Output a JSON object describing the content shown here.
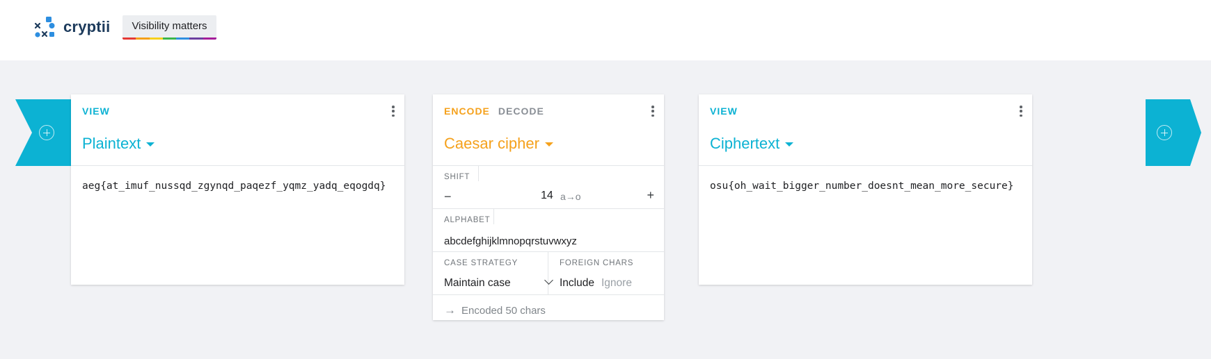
{
  "header": {
    "logo_text": "cryptii",
    "badge_label": "Visibility matters",
    "rainbow_colors": [
      "#e53935",
      "#f4a019",
      "#f7d01c",
      "#3bb54a",
      "#2f8fe0",
      "#6b3fa0",
      "#a51d9a"
    ]
  },
  "colors": {
    "accent_cyan": "#0cb2d3",
    "accent_orange": "#f5a11c"
  },
  "plaintext_card": {
    "tab": "VIEW",
    "title": "Plaintext",
    "content": "aeg{at_imuf_nussqd_zgynqd_paqezf_yqmz_yadq_eqogdq}"
  },
  "caesar_card": {
    "tab_encode": "ENCODE",
    "tab_decode": "DECODE",
    "title": "Caesar cipher",
    "shift": {
      "label": "SHIFT",
      "minus": "−",
      "value": "14",
      "mapping": "a→o",
      "plus": "+"
    },
    "alphabet": {
      "label": "ALPHABET",
      "value": "abcdefghijklmnopqrstuvwxyz"
    },
    "case_strategy": {
      "label": "CASE STRATEGY",
      "value": "Maintain case"
    },
    "foreign_chars": {
      "label": "FOREIGN CHARS",
      "include": "Include",
      "ignore": "Ignore"
    },
    "status": "Encoded 50 chars"
  },
  "ciphertext_card": {
    "tab": "VIEW",
    "title": "Ciphertext",
    "content": "osu{oh_wait_bigger_number_doesnt_mean_more_secure}"
  }
}
